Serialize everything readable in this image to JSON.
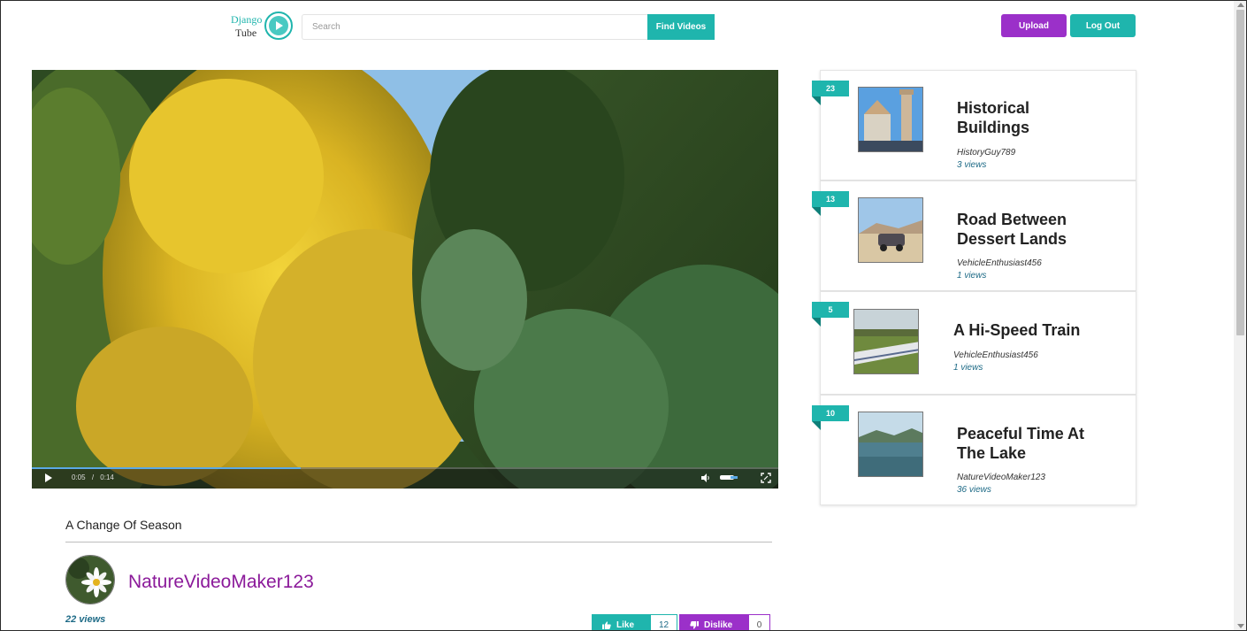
{
  "header": {
    "logo_line1": "Django",
    "logo_line2": "Tube",
    "search_placeholder": "Search",
    "find_label": "Find Videos",
    "upload_label": "Upload",
    "logout_label": "Log Out"
  },
  "player": {
    "current_time": "0:05",
    "separator": "/",
    "duration": "0:14",
    "progress_fraction": 0.36
  },
  "video": {
    "title": "A Change Of Season",
    "channel": "NatureVideoMaker123",
    "views": "22 views",
    "like_label": "Like",
    "like_count": "12",
    "dislike_label": "Dislike",
    "dislike_count": "0"
  },
  "sidebar": {
    "items": [
      {
        "badge": "23",
        "title": "Historical Buildings",
        "author": "HistoryGuy789",
        "views": "3 views"
      },
      {
        "badge": "13",
        "title": "Road Between Dessert Lands",
        "author": "VehicleEnthusiast456",
        "views": "1 views"
      },
      {
        "badge": "5",
        "title": "A Hi-Speed Train",
        "author": "VehicleEnthusiast456",
        "views": "1 views"
      },
      {
        "badge": "10",
        "title": "Peaceful Time At The Lake",
        "author": "NatureVideoMaker123",
        "views": "36 views"
      }
    ]
  },
  "colors": {
    "teal": "#1fb5ad",
    "purple": "#9b30c9",
    "channel": "#8b1a9a",
    "views_blue": "#1d6a86"
  }
}
